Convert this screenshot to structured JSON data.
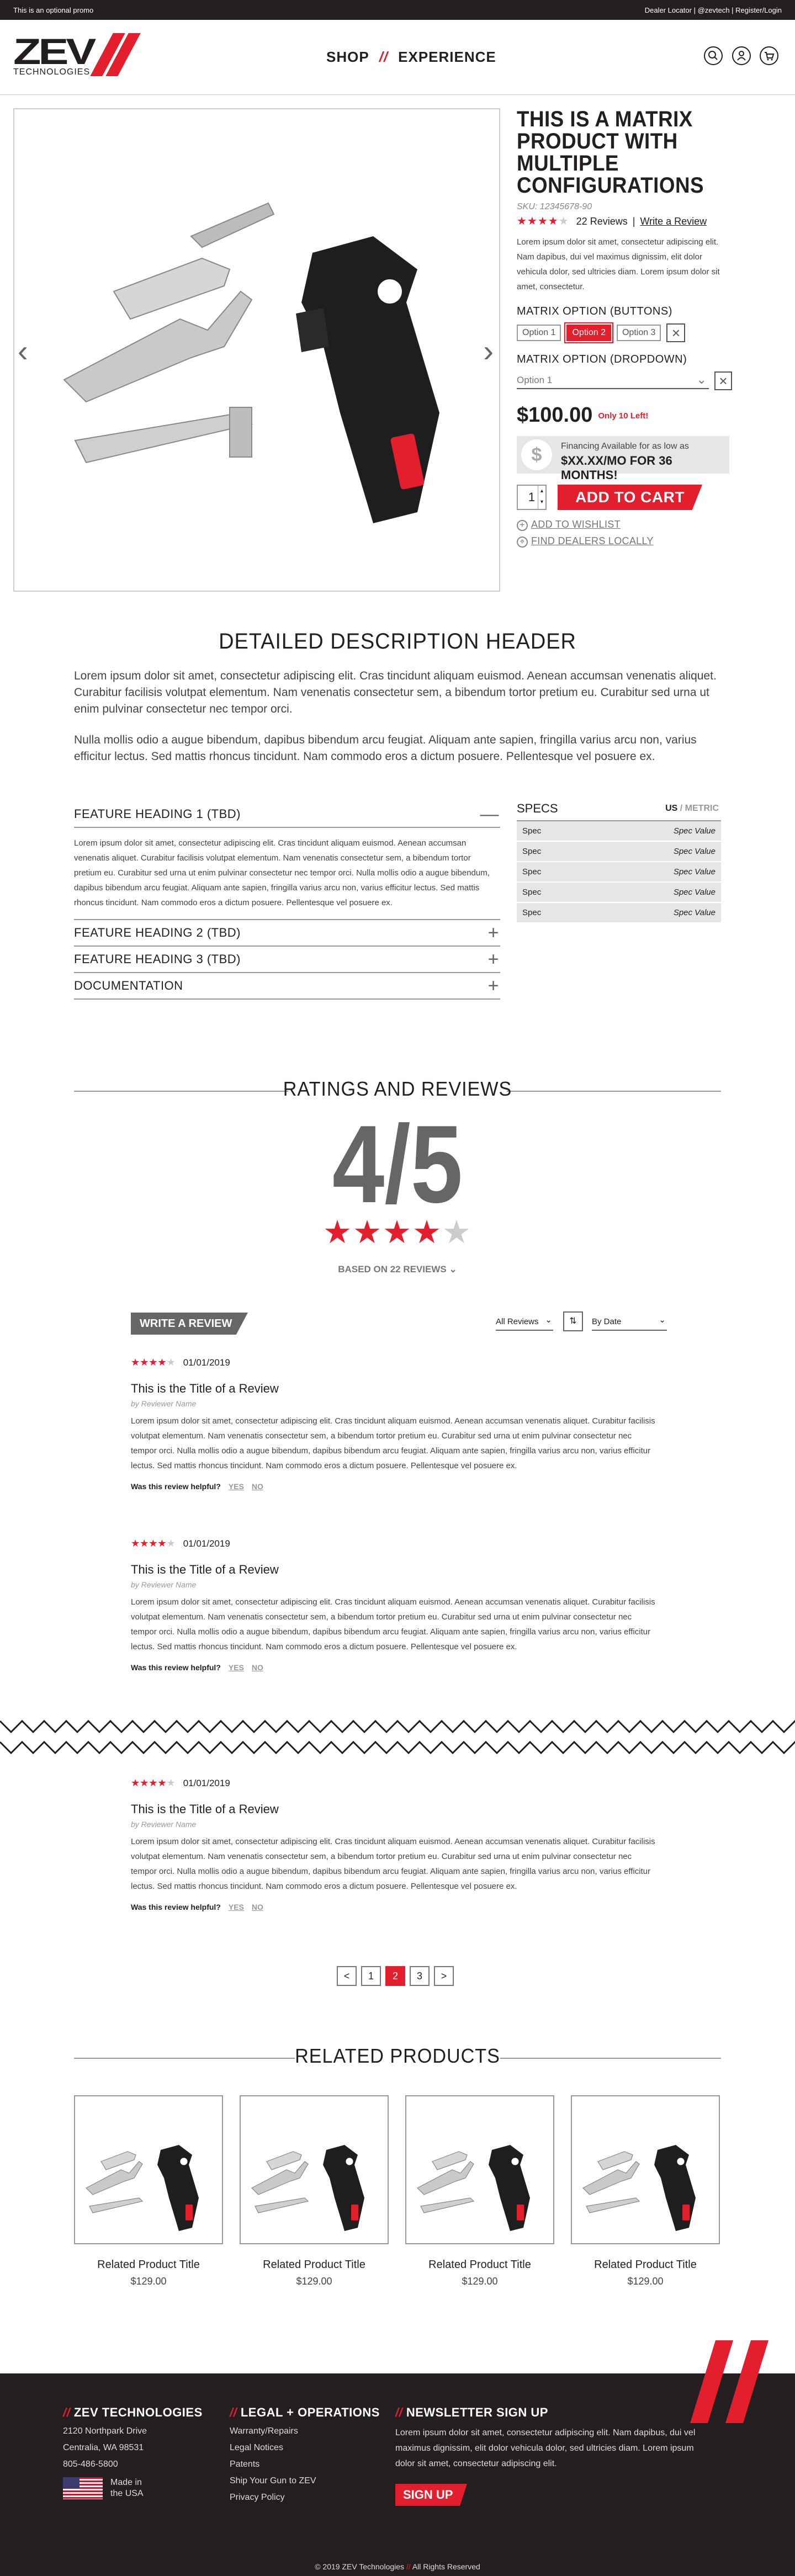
{
  "promo": {
    "left": "This is an optional promo",
    "right": "Dealer Locator | @zevtech | Register/Login"
  },
  "logo": {
    "main": "ZEV",
    "sub": "TECHNOLOGIES"
  },
  "nav": {
    "shop": "SHOP",
    "sep": "//",
    "experience": "EXPERIENCE"
  },
  "header_icons": [
    "search-icon",
    "account-icon",
    "cart-icon"
  ],
  "gallery": {
    "prev": "‹",
    "next": "›"
  },
  "product": {
    "title": "THIS IS A MATRIX PRODUCT WITH MULTIPLE CONFIGURATIONS",
    "sku": "SKU: 12345678-90",
    "rating_stars": 4,
    "reviews": "22 Reviews",
    "write_review": "Write a Review",
    "description": "Lorem ipsum dolor sit amet, consectetur adipiscing elit. Nam dapibus, dui vel maximus dignissim, elit dolor vehicula dolor, sed ultricies diam. Lorem ipsum dolor sit amet, consectetur.",
    "option_buttons_label": "MATRIX OPTION (BUTTONS)",
    "options": [
      "Option 1",
      "Option 2",
      "Option 3"
    ],
    "selected_option": "Option 2",
    "option_dropdown_label": "MATRIX OPTION (DROPDOWN)",
    "dropdown_value": "Option 1",
    "price": "$100.00",
    "stock": "Only 10 Left!",
    "financing_line1": "Financing Available for as low as",
    "financing_line2": "$XX.XX/MO FOR 36 MONTHS!",
    "qty": "1",
    "add_to_cart": "ADD TO CART",
    "wishlist": "ADD TO WISHLIST",
    "dealers": "FIND DEALERS LOCALLY"
  },
  "description": {
    "header": "DETAILED DESCRIPTION HEADER",
    "p1": "Lorem ipsum dolor sit amet, consectetur adipiscing elit. Cras tincidunt aliquam euismod. Aenean accumsan venenatis aliquet. Curabitur facilisis volutpat elementum. Nam venenatis consectetur sem, a bibendum tortor pretium eu. Curabitur sed urna ut enim pulvinar consectetur nec tempor orci.",
    "p2": "Nulla mollis odio a augue bibendum, dapibus bibendum arcu feugiat. Aliquam ante sapien, fringilla varius arcu non, varius efficitur lectus. Sed mattis rhoncus tincidunt. Nam commodo eros a dictum posuere. Pellentesque vel posuere ex."
  },
  "features": {
    "items": [
      "FEATURE HEADING 1 (TBD)",
      "FEATURE HEADING 2 (TBD)",
      "FEATURE HEADING 3 (TBD)",
      "DOCUMENTATION"
    ],
    "body": "Lorem ipsum dolor sit amet, consectetur adipiscing elit. Cras tincidunt aliquam euismod. Aenean accumsan venenatis aliquet. Curabitur facilisis volutpat elementum. Nam venenatis consectetur sem, a bibendum tortor pretium eu. Curabitur sed urna ut enim pulvinar consectetur nec tempor orci. Nulla mollis odio a augue bibendum, dapibus bibendum arcu feugiat. Aliquam ante sapien, fringilla varius arcu non, varius efficitur lectus. Sed mattis rhoncus tincidunt. Nam commodo eros a dictum posuere. Pellentesque vel posuere ex.",
    "minus": "—",
    "plus": "+"
  },
  "specs": {
    "header": "SPECS",
    "us": "US",
    "slash": " / ",
    "metric": "METRIC",
    "rows": [
      {
        "k": "Spec",
        "v": "Spec Value"
      },
      {
        "k": "Spec",
        "v": "Spec Value"
      },
      {
        "k": "Spec",
        "v": "Spec Value"
      },
      {
        "k": "Spec",
        "v": "Spec Value"
      },
      {
        "k": "Spec",
        "v": "Spec Value"
      }
    ]
  },
  "ratings": {
    "header": "RATINGS AND REVIEWS",
    "score": "4/5",
    "stars": 4,
    "based": "BASED ON 22 REVIEWS",
    "write": "WRITE A REVIEW",
    "filter": "All Reviews",
    "sort": "By Date"
  },
  "reviews": [
    {
      "date": "01/01/2019",
      "title": "This is the Title of a Review",
      "name": "by Reviewer Name",
      "stars": 4,
      "body": "Lorem ipsum dolor sit amet, consectetur adipiscing elit. Cras tincidunt aliquam euismod. Aenean accumsan venenatis aliquet. Curabitur facilisis volutpat elementum. Nam venenatis consectetur sem, a bibendum tortor pretium eu. Curabitur sed urna ut enim pulvinar consectetur nec tempor orci. Nulla mollis odio a augue bibendum, dapibus bibendum arcu feugiat. Aliquam ante sapien, fringilla varius arcu non, varius efficitur lectus. Sed mattis rhoncus tincidunt. Nam commodo eros a dictum posuere. Pellentesque vel posuere ex.",
      "helpful": "Was this review helpful?",
      "yes": "YES",
      "no": "NO"
    },
    {
      "date": "01/01/2019",
      "title": "This is the Title of a Review",
      "name": "by Reviewer Name",
      "stars": 4,
      "body": "Lorem ipsum dolor sit amet, consectetur adipiscing elit. Cras tincidunt aliquam euismod. Aenean accumsan venenatis aliquet. Curabitur facilisis volutpat elementum. Nam venenatis consectetur sem, a bibendum tortor pretium eu. Curabitur sed urna ut enim pulvinar consectetur nec tempor orci. Nulla mollis odio a augue bibendum, dapibus bibendum arcu feugiat. Aliquam ante sapien, fringilla varius arcu non, varius efficitur lectus. Sed mattis rhoncus tincidunt. Nam commodo eros a dictum posuere. Pellentesque vel posuere ex.",
      "helpful": "Was this review helpful?",
      "yes": "YES",
      "no": "NO"
    },
    {
      "date": "01/01/2019",
      "title": "This is the Title of a Review",
      "name": "by Reviewer Name",
      "stars": 4,
      "body": "Lorem ipsum dolor sit amet, consectetur adipiscing elit. Cras tincidunt aliquam euismod. Aenean accumsan venenatis aliquet. Curabitur facilisis volutpat elementum. Nam venenatis consectetur sem, a bibendum tortor pretium eu. Curabitur sed urna ut enim pulvinar consectetur nec tempor orci. Nulla mollis odio a augue bibendum, dapibus bibendum arcu feugiat. Aliquam ante sapien, fringilla varius arcu non, varius efficitur lectus. Sed mattis rhoncus tincidunt. Nam commodo eros a dictum posuere. Pellentesque vel posuere ex.",
      "helpful": "Was this review helpful?",
      "yes": "YES",
      "no": "NO"
    }
  ],
  "pager": {
    "prev": "<",
    "pages": [
      "1",
      "2",
      "3"
    ],
    "current": "2",
    "next": ">"
  },
  "related": {
    "header": "RELATED PRODUCTS",
    "items": [
      {
        "name": "Related Product Title",
        "price": "$129.00"
      },
      {
        "name": "Related Product Title",
        "price": "$129.00"
      },
      {
        "name": "Related Product Title",
        "price": "$129.00"
      },
      {
        "name": "Related Product Title",
        "price": "$129.00"
      }
    ]
  },
  "footer": {
    "slash": "//",
    "col1": {
      "title": "ZEV TECHNOLOGIES",
      "lines": [
        "2120 Northpark Drive",
        "Centralia, WA 98531",
        "805-486-5800"
      ],
      "made1": "Made in",
      "made2": "the USA"
    },
    "col2": {
      "title": "LEGAL + OPERATIONS",
      "links": [
        "Warranty/Repairs",
        "Legal Notices",
        "Patents",
        "Ship Your Gun to ZEV",
        "Privacy Policy"
      ]
    },
    "col3": {
      "title": "NEWSLETTER SIGN UP",
      "text": "Lorem ipsum dolor sit amet, consectetur adipiscing elit. Nam dapibus, dui vel maximus dignissim, elit dolor vehicula dolor, sed ultricies diam. Lorem ipsum dolor sit amet, consectetur adipiscing elit.",
      "button": "SIGN UP"
    },
    "copy_a": "© 2019 ZEV Technologies",
    "copy_sep": "//",
    "copy_b": "All Rights Reserved"
  },
  "colors": {
    "accent": "#e31e2d",
    "dark": "#231f20",
    "mid": "#666666",
    "light": "#e6e6e6"
  }
}
